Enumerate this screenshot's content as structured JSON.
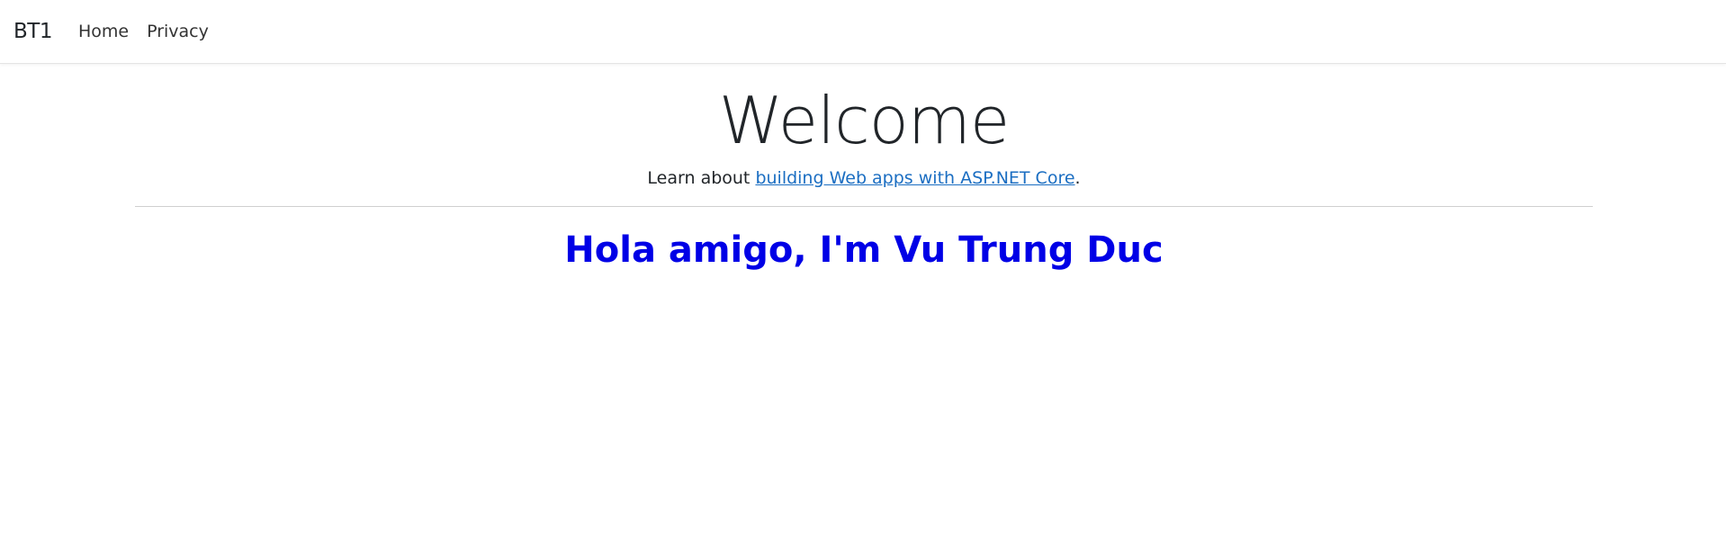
{
  "navbar": {
    "brand": "BT1",
    "links": [
      {
        "label": "Home"
      },
      {
        "label": "Privacy"
      }
    ]
  },
  "main": {
    "title": "Welcome",
    "learn_prefix": "Learn about ",
    "learn_link_text": "building Web apps with ASP.NET Core",
    "learn_suffix": ".",
    "greeting": "Hola amigo, I'm Vu Trung Duc"
  },
  "colors": {
    "link": "#1b6ec2",
    "greeting": "#0000e6",
    "text": "#212529"
  }
}
